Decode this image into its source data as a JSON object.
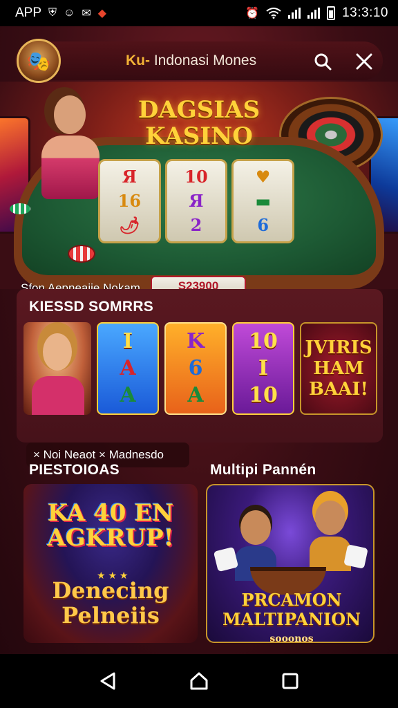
{
  "status_bar": {
    "left_text": "APP",
    "left_icons": [
      "shield-icon",
      "at-icon",
      "chat-icon",
      "alert-icon"
    ],
    "time": "13:3:10",
    "right_icons": [
      "alarm-icon",
      "wifi-icon",
      "signal-icon",
      "signal-icon",
      "battery-icon"
    ]
  },
  "header": {
    "title_accent": "Ku-",
    "title_rest": " Indonasi Mones",
    "avatar_icon": "dealer-avatar-icon",
    "search_icon": "search-icon",
    "close_icon": "close-icon"
  },
  "hero": {
    "title_line1": "DAGSIAS",
    "title_line2": "KASINO",
    "reels": [
      [
        {
          "t": "Я",
          "c": "red"
        },
        {
          "t": "16",
          "c": "gold"
        },
        {
          "t": "🌶",
          "c": "red"
        }
      ],
      [
        {
          "t": "10",
          "c": "red"
        },
        {
          "t": "Я",
          "c": "purple"
        },
        {
          "t": "2",
          "c": "purple"
        }
      ],
      [
        {
          "t": "♥",
          "c": "gold"
        },
        {
          "t": "▬",
          "c": "green"
        },
        {
          "t": "6",
          "c": "blue"
        }
      ]
    ],
    "label": "Sfon Aepneaiie Nokam",
    "amount": "S23900"
  },
  "featured": {
    "heading": "KIESSD SOMRRS",
    "tiles": [
      {
        "type": "dealer"
      },
      {
        "type": "slot",
        "style": "blue",
        "symbols": [
          "I",
          "A",
          "A"
        ]
      },
      {
        "type": "slot",
        "style": "orange",
        "symbols": [
          "K",
          "6",
          "A"
        ]
      },
      {
        "type": "slot",
        "style": "purple",
        "symbols": [
          "10",
          "I",
          "10"
        ]
      },
      {
        "type": "promo",
        "lines": [
          "JVIRIS",
          "HAM",
          "BAAI!"
        ]
      }
    ],
    "caption": "× Noi Neaot × Madnesdo"
  },
  "section2": {
    "heading_left": "PIESTOIOAS",
    "heading_right": "Multipi Pannén",
    "card_left": {
      "title_line1": "KA 40 EN",
      "title_line2": "AGKRUP!",
      "stars": "★ ★ ★",
      "sub_line1": "Denecing",
      "sub_line2": "Pelneiis"
    },
    "card_right": {
      "title_line1": "PRCAMON",
      "title_line2": "MALTIPANION",
      "title_small": "sooonos"
    }
  },
  "nav": {
    "back_icon": "back-triangle-icon",
    "home_icon": "home-icon",
    "recents_icon": "recents-square-icon"
  },
  "colors": {
    "background": "#3a0d14",
    "accent_gold": "#ffd23a",
    "table_green": "#1d5a34",
    "amount_red": "#b0192a"
  }
}
